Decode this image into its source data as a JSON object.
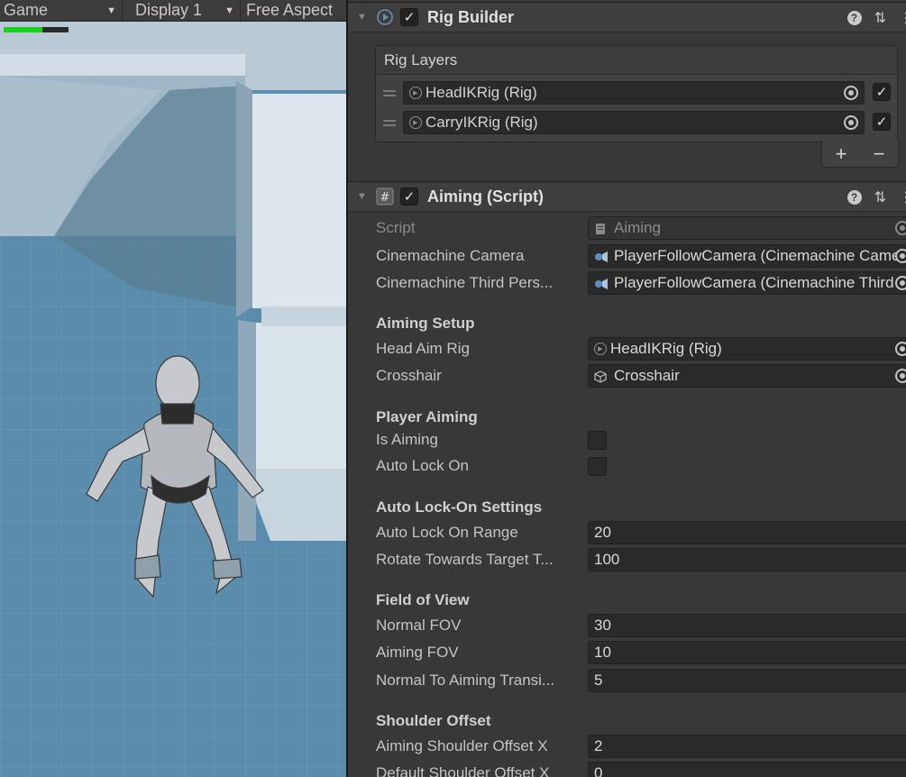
{
  "game_view": {
    "tab_label": "Game",
    "display_label": "Display 1",
    "aspect_label": "Free Aspect",
    "progress": 0.6
  },
  "rig_builder": {
    "title": "Rig Builder",
    "enabled": true,
    "list_header": "Rig Layers",
    "layers": [
      {
        "name": "HeadIKRig (Rig)",
        "active": true
      },
      {
        "name": "CarryIKRig (Rig)",
        "active": true
      }
    ],
    "add_label": "+",
    "remove_label": "−"
  },
  "aiming": {
    "title": "Aiming (Script)",
    "enabled": true,
    "script": {
      "label": "Script",
      "value": "Aiming"
    },
    "cinemachine_camera": {
      "label": "Cinemachine Camera",
      "value": "PlayerFollowCamera (Cinemachine Camera)"
    },
    "third_person": {
      "label": "Cinemachine Third Pers...",
      "value": "PlayerFollowCamera (Cinemachine Third Person Follow)"
    },
    "aiming_setup": {
      "header": "Aiming Setup",
      "head_aim_rig": {
        "label": "Head Aim Rig",
        "value": "HeadIKRig (Rig)"
      },
      "crosshair": {
        "label": "Crosshair",
        "value": "Crosshair"
      }
    },
    "player_aiming": {
      "header": "Player Aiming",
      "is_aiming": {
        "label": "Is Aiming",
        "checked": false
      },
      "auto_lock_on": {
        "label": "Auto Lock On",
        "checked": false
      }
    },
    "auto_lock": {
      "header": "Auto Lock-On Settings",
      "range": {
        "label": "Auto Lock On Range",
        "value": "20"
      },
      "rotate": {
        "label": "Rotate Towards Target T...",
        "value": "100"
      }
    },
    "fov": {
      "header": "Field of View",
      "normal": {
        "label": "Normal FOV",
        "value": "30"
      },
      "aiming": {
        "label": "Aiming FOV",
        "value": "10"
      },
      "transition": {
        "label": "Normal To Aiming Transi...",
        "value": "5"
      }
    },
    "shoulder": {
      "header": "Shoulder Offset",
      "aiming_x": {
        "label": "Aiming Shoulder Offset X",
        "value": "2"
      },
      "default_x": {
        "label": "Default Shoulder Offset X",
        "value": "0"
      }
    }
  },
  "colors": {
    "progress_green": "#19d41d",
    "floor_blue": "#5b8eac",
    "panel_bg": "#383838"
  }
}
